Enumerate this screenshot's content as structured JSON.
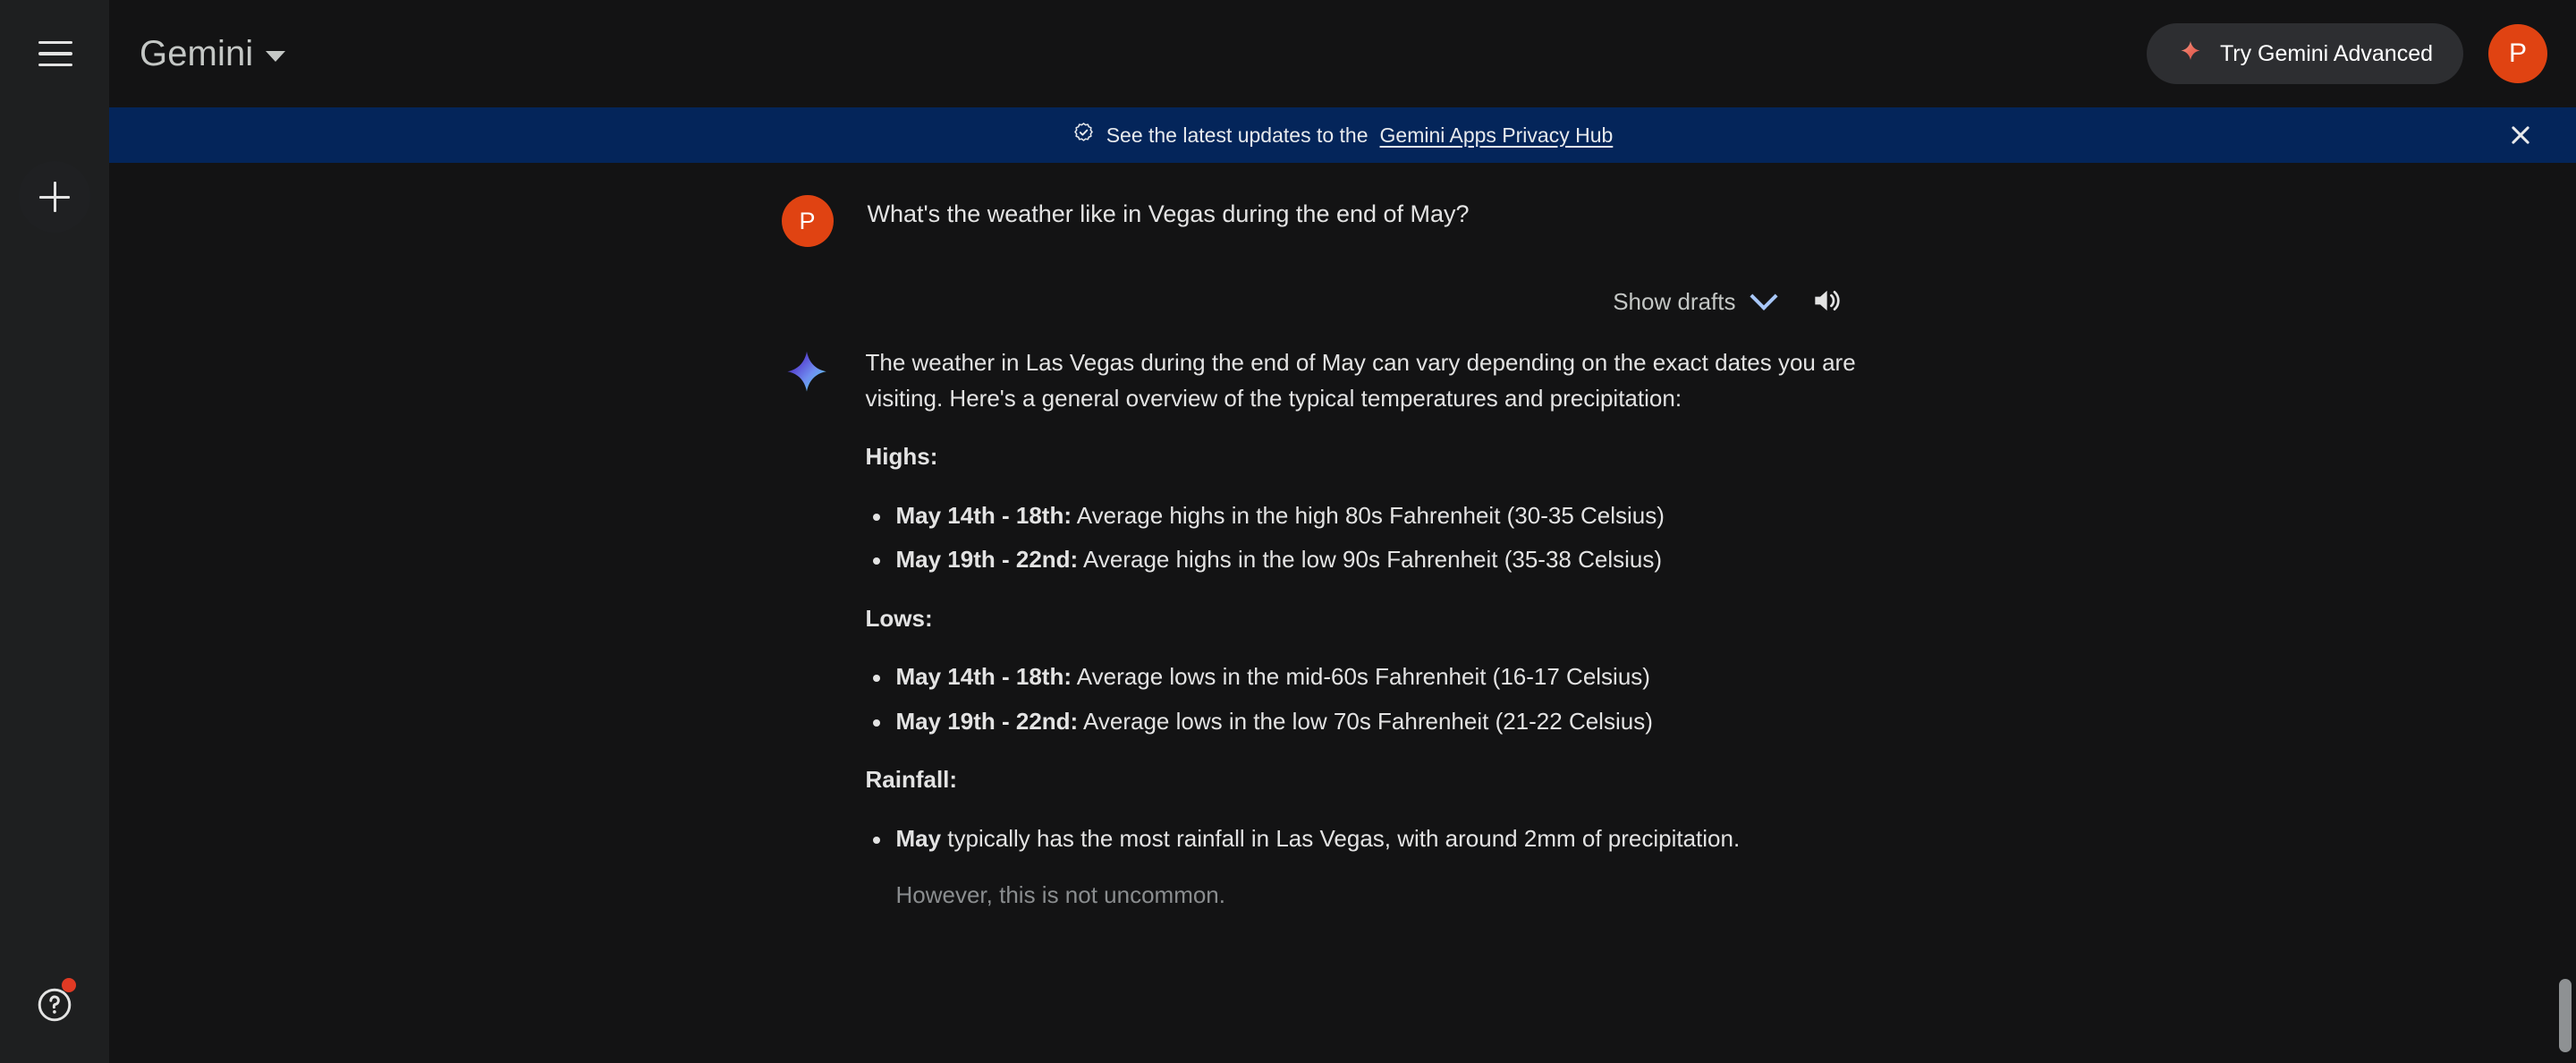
{
  "app": {
    "brand_title": "Gemini",
    "background_color": "#131314",
    "sidebar_color": "#1e1f20",
    "accent_color": "#a8c7fa",
    "avatar_color": "#e04312"
  },
  "sidebar": {
    "menu_icon": "hamburger-menu-icon",
    "new_chat_icon": "plus-icon",
    "help_icon": "help-question-mark-icon",
    "help_badge_color": "#e03a24"
  },
  "topbar": {
    "brand_title": "Gemini",
    "brand_caret_icon": "chevron-down-icon",
    "advanced_button_label": "Try Gemini Advanced",
    "advanced_button_icon": "sparkle-icon",
    "avatar_initial": "P"
  },
  "banner": {
    "icon": "verified-badge-icon",
    "text_before": "See the latest updates to the",
    "link_label": "Gemini Apps Privacy Hub",
    "close_icon": "close-x-icon",
    "background_color": "#04255a"
  },
  "conversation": {
    "user": {
      "avatar_initial": "P",
      "message": "What's the weather like in Vegas during the end of May?"
    },
    "controls": {
      "show_drafts_label": "Show drafts",
      "show_drafts_icon": "chevron-down-icon",
      "speaker_icon": "volume-speaker-icon"
    },
    "answer": {
      "gemini_icon": "gemini-sparkle-icon",
      "intro": "The weather in Las Vegas during the end of May can vary depending on the exact dates you are visiting. Here's a general overview of the typical temperatures and precipitation:",
      "sections": [
        {
          "heading": "Highs:",
          "items": [
            {
              "bold": "May 14th - 18th:",
              "text": " Average highs in the high 80s Fahrenheit (30-35 Celsius)"
            },
            {
              "bold": "May 19th - 22nd:",
              "text": " Average highs in the low 90s Fahrenheit (35-38 Celsius)"
            }
          ]
        },
        {
          "heading": "Lows:",
          "items": [
            {
              "bold": "May 14th - 18th:",
              "text": " Average lows in the mid-60s Fahrenheit (16-17 Celsius)"
            },
            {
              "bold": "May 19th - 22nd:",
              "text": " Average lows in the low 70s Fahrenheit (21-22 Celsius)"
            }
          ]
        },
        {
          "heading": "Rainfall:",
          "items": [
            {
              "bold": "May",
              "text": " typically has the most rainfall in Las Vegas, with around 2mm of precipitation."
            }
          ],
          "trailing_text": "However, this is not uncommon."
        }
      ]
    }
  },
  "scrollbar": {
    "thumb_color": "#8e9193"
  }
}
